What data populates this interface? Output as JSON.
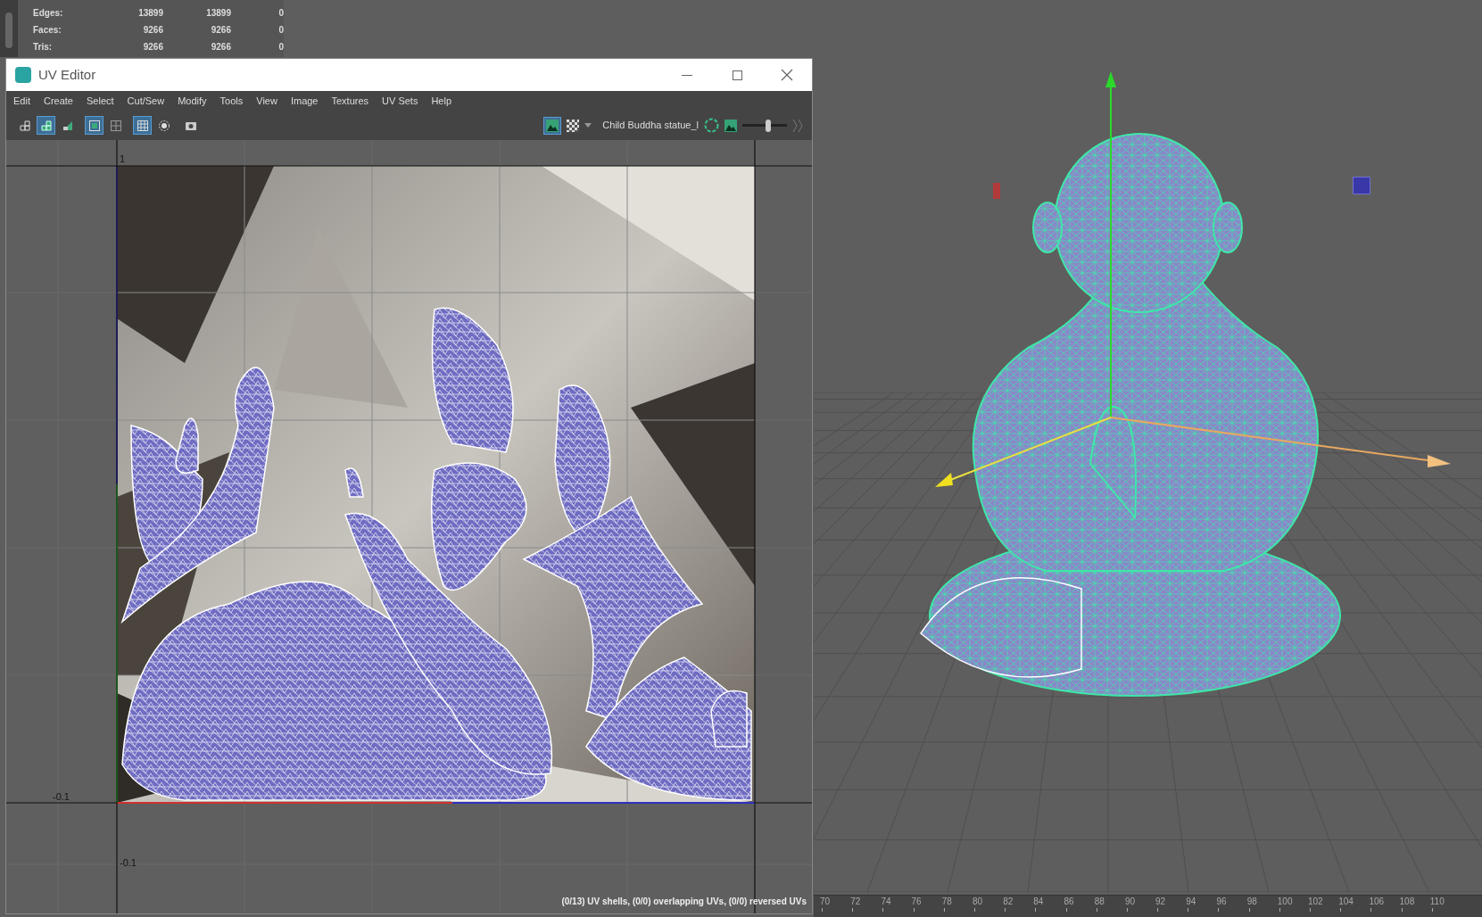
{
  "stats": [
    {
      "label": "Edges:",
      "col_1": "13899",
      "col_2": "13899",
      "col_3": "0"
    },
    {
      "label": "Faces:",
      "col_1": "9266",
      "col_2": "9266",
      "col_3": "0"
    },
    {
      "label": "Tris:",
      "col_1": "9266",
      "col_2": "9266",
      "col_3": "0"
    }
  ],
  "uv_editor": {
    "title": "UV Editor",
    "menu": [
      "Edit",
      "Create",
      "Select",
      "Cut/Sew",
      "Modify",
      "Tools",
      "View",
      "Image",
      "Textures",
      "UV Sets",
      "Help"
    ],
    "toolbar_left": [
      {
        "kind": "layout",
        "on": false
      },
      {
        "kind": "shaded",
        "on": true
      },
      {
        "kind": "distortion",
        "on": false
      },
      {
        "kind": "frame",
        "on": true
      },
      {
        "kind": "grid-small",
        "on": false
      },
      {
        "kind": "grid",
        "on": true
      },
      {
        "kind": "ring",
        "on": false
      },
      {
        "kind": "camera",
        "on": false
      }
    ],
    "toolbar_right": {
      "image_toggle_on": true,
      "image_name": "Child Buddha statue_l",
      "exposure": {
        "level": 0.6
      }
    },
    "canvas_labels": [
      {
        "kind": "u-top",
        "text": "1"
      },
      {
        "kind": "left",
        "text": "-0.1"
      },
      {
        "kind": "bottom",
        "text": "-0.1"
      }
    ],
    "status": "(0/13) UV shells, (0/0) overlapping UVs, (0/0) reversed UVs"
  },
  "timeline": [
    "70",
    "72",
    "74",
    "76",
    "78",
    "80",
    "82",
    "84",
    "86",
    "88",
    "90",
    "92",
    "94",
    "96",
    "98",
    "100",
    "102",
    "104",
    "106",
    "108",
    "110"
  ]
}
